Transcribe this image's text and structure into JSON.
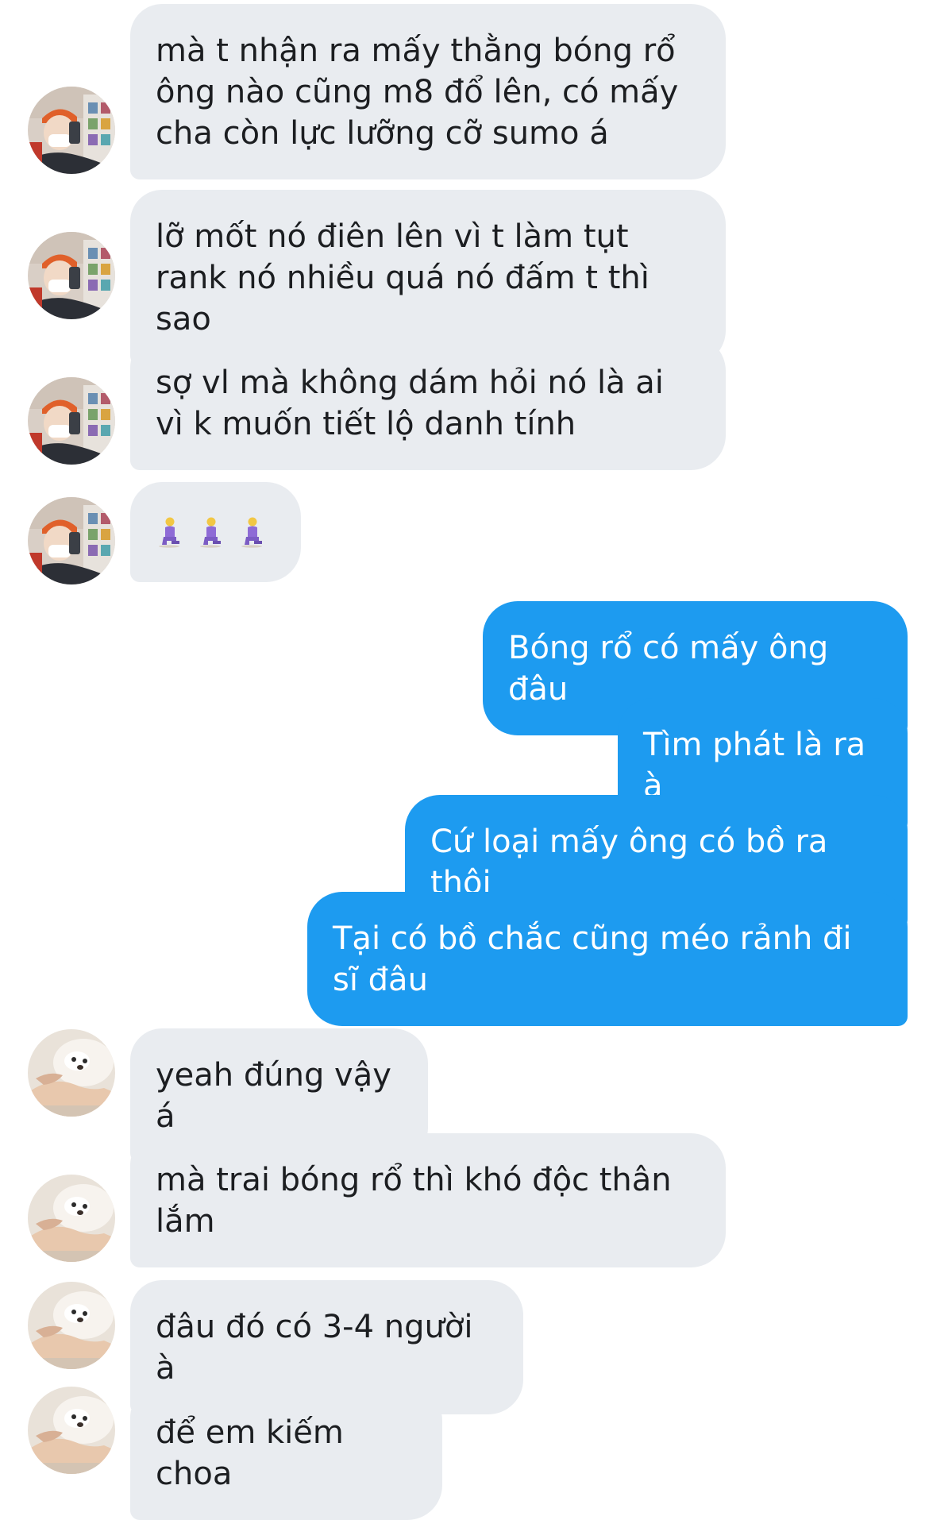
{
  "conversation": {
    "incoming_a": [
      "mà t nhận ra mấy thằng bóng rổ ông nào cũng m8 đổ lên, có mấy cha còn lực lưỡng cỡ sumo á",
      "lỡ mốt nó điên lên vì t làm tụt rank nó nhiều quá nó đấm t thì sao",
      "sợ vl mà không dám hỏi nó là ai vì k muốn tiết lộ danh tính"
    ],
    "emoji_message": {
      "count": 3,
      "icon": "person-kneeling-emoji"
    },
    "outgoing": [
      "Bóng rổ có mấy ông đâu",
      "Tìm phát là ra à",
      "Cứ loại mấy ông có bồ ra thôi",
      "Tại có bồ chắc cũng méo rảnh đi sĩ đâu"
    ],
    "incoming_b": [
      "yeah đúng vậy á",
      "mà trai bóng rổ thì khó độc thân lắm",
      "đâu đó có 3-4 người à",
      "để em kiếm choa"
    ]
  },
  "colors": {
    "incoming_bubble": "#e9ecf0",
    "outgoing_bubble": "#1d9bf0",
    "incoming_text": "#1c1e21",
    "outgoing_text": "#ffffff"
  },
  "avatars": {
    "sender_a": "avatar-person-selfie",
    "sender_b": "avatar-puppy"
  }
}
